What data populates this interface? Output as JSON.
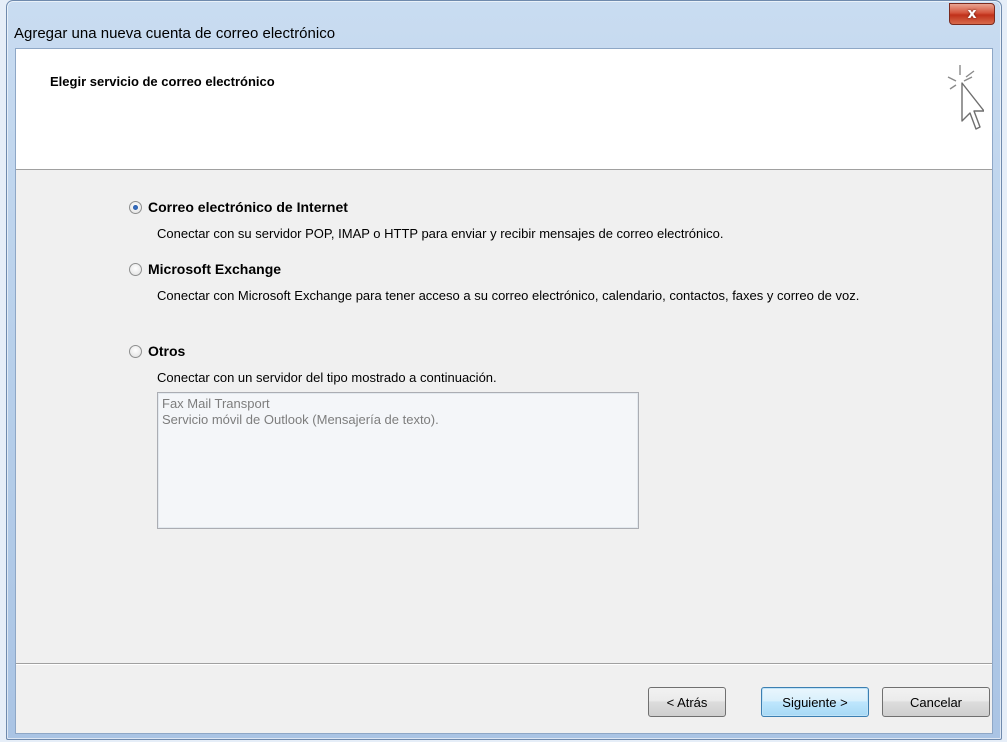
{
  "window": {
    "title": "Agregar una nueva cuenta de correo electrónico",
    "close_label": "x"
  },
  "header": {
    "title": "Elegir servicio de correo electrónico",
    "icon": "wizard-cursor-icon"
  },
  "options": [
    {
      "label": "Correo electrónico de Internet",
      "description": "Conectar con su servidor POP, IMAP o HTTP para enviar y recibir mensajes de correo electrónico.",
      "selected": true
    },
    {
      "label": "Microsoft Exchange",
      "description": "Conectar con Microsoft Exchange para tener acceso a su correo electrónico, calendario, contactos, faxes y correo de voz.",
      "selected": false
    },
    {
      "label": "Otros",
      "description": "Conectar con un servidor del tipo mostrado a continuación.",
      "selected": false
    }
  ],
  "other_services": [
    "Fax Mail Transport",
    "Servicio móvil de Outlook (Mensajería de texto)."
  ],
  "buttons": {
    "back": "< Atrás",
    "next": "Siguiente >",
    "cancel": "Cancelar"
  },
  "colors": {
    "accent": "#3c7fb1",
    "close": "#c0311a"
  }
}
